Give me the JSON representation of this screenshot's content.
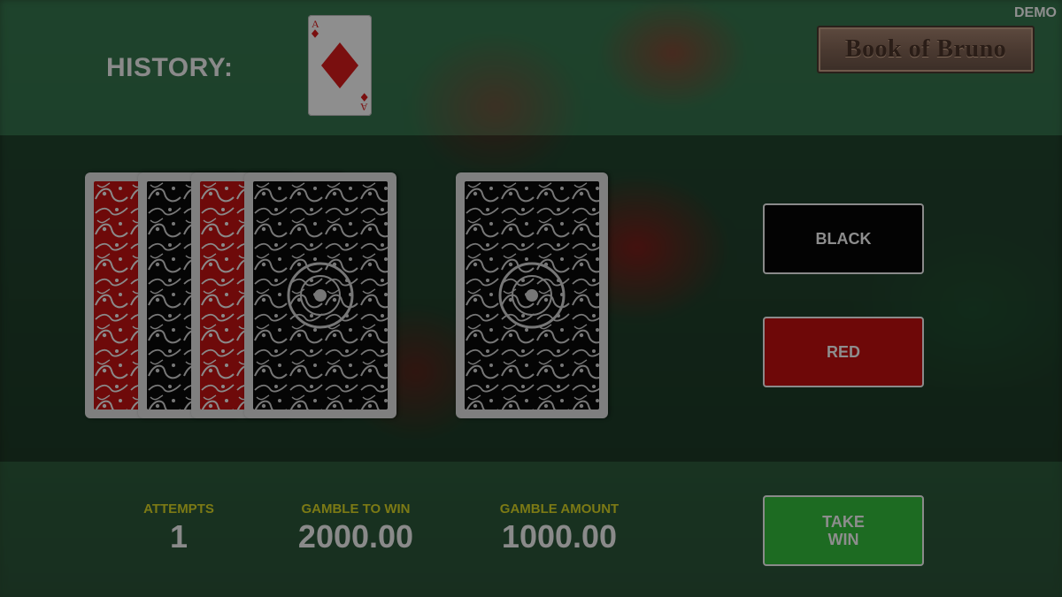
{
  "demo_label": "DEMO",
  "history": {
    "label": "HISTORY:",
    "cards": [
      {
        "rank": "A",
        "suit": "diamonds",
        "color": "#7a0f0f"
      }
    ]
  },
  "logo": {
    "text": "Book of Bruno"
  },
  "deck": {
    "card_backs": [
      {
        "color": "red",
        "pattern": "floral"
      },
      {
        "color": "black",
        "pattern": "floral"
      },
      {
        "color": "red",
        "pattern": "floral"
      },
      {
        "color": "black",
        "pattern": "floral"
      }
    ],
    "active_card": {
      "color": "black",
      "pattern": "floral",
      "face": "down"
    }
  },
  "buttons": {
    "black": "BLACK",
    "red": "RED",
    "take_win": "TAKE\nWIN"
  },
  "stats": {
    "attempts": {
      "label": "ATTEMPTS",
      "value": "1"
    },
    "gamble_to_win": {
      "label": "GAMBLE TO WIN",
      "value": "2000.00"
    },
    "gamble_amount": {
      "label": "GAMBLE AMOUNT",
      "value": "1000.00"
    }
  },
  "colors": {
    "black_button": "#030303",
    "red_button": "#6e0808",
    "take_win_button": "#1d6b22",
    "stat_label": "#7c7a15",
    "stat_value": "#8a8a8a"
  }
}
